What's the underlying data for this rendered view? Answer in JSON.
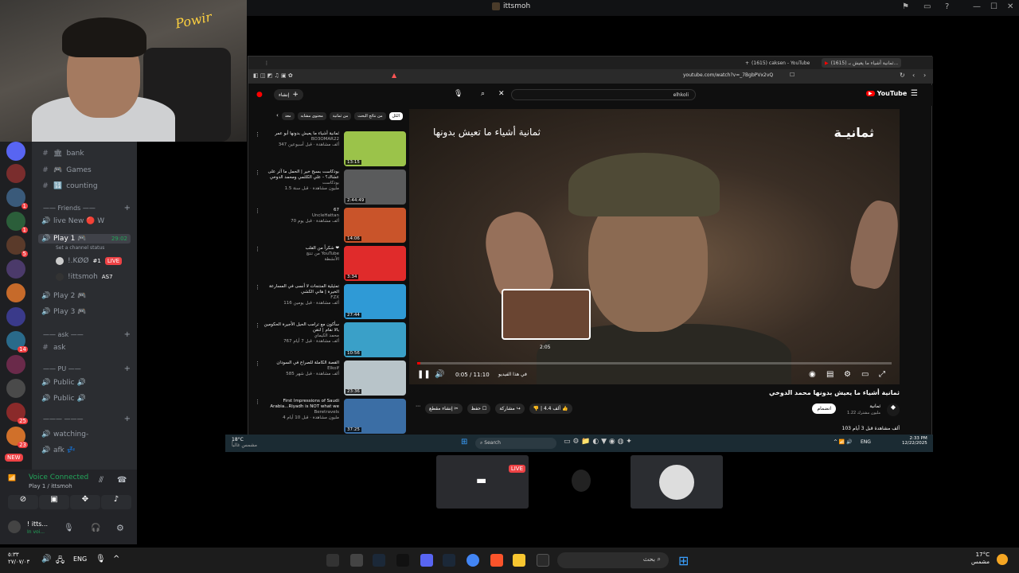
{
  "window": {
    "title": "ittsmoh"
  },
  "webcam": {
    "sign": "Powir"
  },
  "discord": {
    "channels": [
      {
        "name": "bank"
      },
      {
        "name": "Games"
      },
      {
        "name": "counting"
      }
    ],
    "friends_category": "Friends",
    "voice_channels": [
      {
        "name": "live New 🔴 W"
      },
      {
        "name": "Play 1 🎮",
        "time": "29:02",
        "status": "Set a channel status"
      },
      {
        "name": "Play 2 🎮"
      },
      {
        "name": "Play 3 🎮"
      }
    ],
    "members": [
      {
        "name": "!.KØØ",
        "badge": "#1",
        "live": "LIVE"
      },
      {
        "name": "!ittsmoh",
        "badge": "AS7"
      }
    ],
    "ask_category": "ask",
    "ask_channel": "ask",
    "pu_category": "PU",
    "public_channels": [
      "Public 🔊",
      "Public 🔊"
    ],
    "watching": "watching-",
    "afk": "afk 💤",
    "new_badge": "NEW",
    "voice_connected": "Voice Connected",
    "voice_sub": "Play 1 / ittsmoh",
    "user": {
      "name": "! itts...",
      "status": "In voi..."
    },
    "server_badges": [
      "1",
      "1",
      "5",
      "14",
      "25",
      "23"
    ]
  },
  "browser": {
    "tabs": [
      {
        "label": "(1615) caksen - YouTube"
      },
      {
        "label": "(1615) ثمانية أشياء ما يعيش بـ..."
      }
    ],
    "url": "youtube.com/watch?v=_7BgbPVx2vQ",
    "search_value": "elhkoli",
    "youtube_label": "YouTube",
    "create_label": "إنشاء",
    "chips": [
      "الكل",
      "من نتائج البحث",
      "من ثمانية",
      "محتوى مشابه",
      "معد"
    ],
    "video": {
      "overlay_title": "ثمانية أشياء ما تعيش بدونها",
      "logo_text": "ثمانيـة",
      "preview_time": "2:05",
      "time": "0:05 / 11:10",
      "chapter": "في هذا الفيديو",
      "progress": 0.007,
      "title": "ثمانية أشياء ما يعيش بدونها محمد الدوخي",
      "channel": "ثمانية",
      "subs": "1.22 مليون مشترك",
      "join": "انضمام",
      "likes": "4.4 ألف",
      "share": "مشاركة",
      "save": "حفظ",
      "clip": "إنشاء مقطع",
      "views": "103 ألف مشاهدة  قبل 3 أيام"
    },
    "sidebar": [
      {
        "title": "ثمانية أشياء ما يعيش بدونها أبو عمر",
        "channel": "BO3OMAR22",
        "meta": "347 ألف مشاهدة · قبل أسبوعين",
        "duration": "13:15",
        "color": "#9bc34a"
      },
      {
        "title": "بودكاست بسبح خير | الحمل ما آثر على عشاك؟ - علي الكلثمي ومحمد الدوخي",
        "channel": "بودكاست",
        "meta": "1.5 مليون مشاهدة · قبل سنة",
        "duration": "2:44:49",
        "color": "#5a5b5c"
      },
      {
        "title": "67",
        "channel": "UncleHattan",
        "meta": "70 ألف مشاهدة · قبل يوم",
        "duration": "14:06",
        "color": "#c9542a"
      },
      {
        "title": "شكراً من القلب ❤",
        "channel": "من تنتج YouTube",
        "meta": "الأنشطة",
        "duration": "3:34",
        "color": "#e02b2b"
      },
      {
        "title": "تمثيلية المنتجات لا أنسى في المسارعة الخيرة | هاني الكشي",
        "channel": "FZX",
        "meta": "116 ألف مشاهدة · قبل يومين",
        "duration": "27:44",
        "color": "#2f9ad6"
      },
      {
        "title": "سأكون مع ترامب الحيل الأجيرة الحكومين بالا نقام | لتقن",
        "channel": "محمد الكيماي",
        "meta": "767 ألف مشاهدة · قبل 7 أيام",
        "duration": "10:56",
        "color": "#3aa0c8"
      },
      {
        "title": "القصة الكاملة للصراع في السودان",
        "channel": "Elkolf",
        "meta": "585 ألف مشاهدة · قبل شهر",
        "duration": "23:36",
        "color": "#b8c4c9"
      },
      {
        "title": "First Impressions of Saudi Arabia...Riyadh is NOT what we",
        "channel": "Beretravels",
        "meta": "4 مليون مشاهدة · قبل 10 أيام",
        "duration": "37:25",
        "color": "#3b6ea5"
      }
    ]
  },
  "innertask": {
    "weather": "18°C",
    "weather_sub": "مشمس غالباً",
    "search": "Search",
    "lang": "ENG",
    "time": "2:33 PM",
    "date": "12/22/2025"
  },
  "stage": {
    "live": "LIVE"
  },
  "taskbar": {
    "clock": "٥:٣٣",
    "date": "٢٧/٠٧/٠٣",
    "lang": "ENG",
    "search": "بحث",
    "temp": "17°C",
    "weather": "مشمس"
  }
}
